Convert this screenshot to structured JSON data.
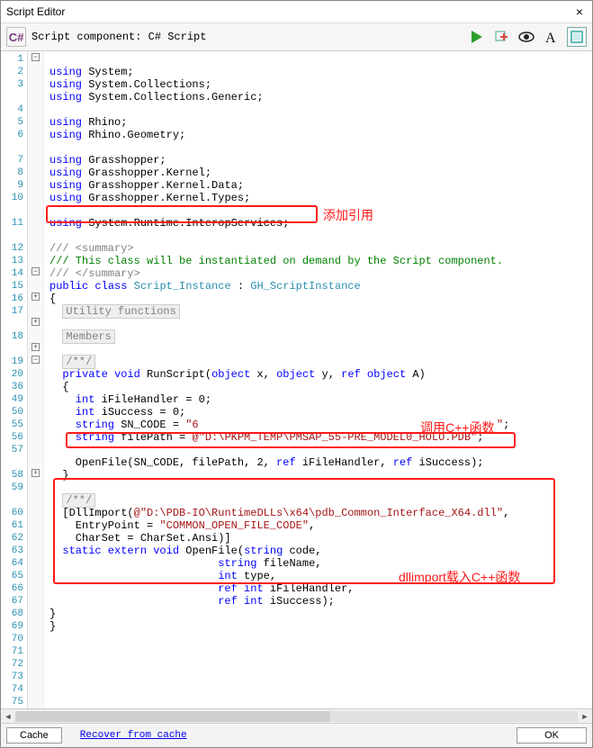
{
  "window": {
    "title": "Script Editor",
    "close": "×"
  },
  "toolbar": {
    "cs_icon": "C#",
    "component_label": "Script component: C# Script"
  },
  "gutter_lines": [
    "1",
    "2",
    "3",
    "4",
    "5",
    "6",
    "7",
    "8",
    "9",
    "10",
    "11",
    "12",
    "13",
    "14",
    "15",
    "16",
    "17",
    "18",
    "19",
    "20",
    "36",
    "49",
    "50",
    "55",
    "56",
    "57",
    "58",
    "59",
    "60",
    "61",
    "62",
    "63",
    "64",
    "65",
    "66",
    "67",
    "68",
    "69",
    "70",
    "71",
    "72",
    "73",
    "74",
    "75"
  ],
  "code": {
    "l1": {
      "kw": "using",
      "id": " System;"
    },
    "l2": {
      "kw": "using",
      "id": " System.Collections;"
    },
    "l3": {
      "kw": "using",
      "id": " System.Collections.Generic;"
    },
    "l5": {
      "kw": "using",
      "id": " Rhino;"
    },
    "l6": {
      "kw": "using",
      "id": " Rhino.Geometry;"
    },
    "l8": {
      "kw": "using",
      "id": " Grasshopper;"
    },
    "l9": {
      "kw": "using",
      "id": " Grasshopper.Kernel;"
    },
    "l10": {
      "kw": "using",
      "id": " Grasshopper.Kernel.Data;"
    },
    "l11": {
      "kw": "using",
      "id": " Grasshopper.Kernel.Types;"
    },
    "l13": {
      "kw": "using",
      "id": " System.Runtime.InteropServices;"
    },
    "l15": "/// <summary>",
    "l16": "/// This class will be instantiated on demand by the Script component.",
    "l17": "/// </summary>",
    "l18a": "public",
    "l18b": " class",
    "l18c": " Script_Instance",
    "l18d": " : ",
    "l18e": "GH_ScriptInstance",
    "l19": "{",
    "l20": "Utility functions",
    "l36": "Members",
    "l50": "/**/",
    "l55a": "private",
    "l55b": " void",
    "l55c": " RunScript(",
    "l55d": "object",
    "l55e": " x, ",
    "l55f": "object",
    "l55g": " y, ",
    "l55h": "ref",
    "l55i": " object",
    "l55j": " A)",
    "l56": "  {",
    "l57a": "    int",
    "l57b": " iFileHandler = 0;",
    "l58a": "    int",
    "l58b": " iSuccess = 0;",
    "l59a": "    string",
    "l59b": " SN_CODE = ",
    "l59c": "\"6                                              \"",
    "l59d": ";",
    "l60a": "    string",
    "l60b": " filePath = ",
    "l60c": "@\"D:\\PKPM_TEMP\\PMSAP_55-PRE_MODEL0_HOLO.PDB\"",
    "l60d": ";",
    "l62a": "    OpenFile(SN_CODE, filePath, 2, ",
    "l62b": "ref",
    "l62c": " iFileHandler, ",
    "l62d": "ref",
    "l62e": " iSuccess);",
    "l63": "  }",
    "l65": "/**/",
    "l66a": "  [DllImport(",
    "l66b": "@\"D:\\PDB-IO\\RuntimeDLLs\\x64\\pdb_Common_Interface_X64.dll\"",
    "l66c": ",",
    "l67a": "    EntryPoint = ",
    "l67b": "\"COMMON_OPEN_FILE_CODE\"",
    "l67c": ",",
    "l68": "    CharSet = CharSet.Ansi)]",
    "l69a": "  static",
    "l69b": " extern",
    "l69c": " void",
    "l69d": " OpenFile(",
    "l69e": "string",
    "l69f": " code,",
    "l70a": "                          ",
    "l70b": "string",
    "l70c": " fileName,",
    "l71a": "                          ",
    "l71b": "int",
    "l71c": " type,",
    "l72a": "                          ",
    "l72b": "ref",
    "l72c": " int",
    "l72d": " iFileHandler,",
    "l73a": "                          ",
    "l73b": "ref",
    "l73c": " int",
    "l73d": " iSuccess);",
    "l74": "}",
    "l75": "}"
  },
  "annotations": {
    "add_ref": "添加引用",
    "call_cpp": "调用C++函数",
    "dllimport": "dllimport载入C++函数"
  },
  "statusbar": {
    "cache": "Cache",
    "recover": "Recover from cache",
    "ok": "OK"
  }
}
